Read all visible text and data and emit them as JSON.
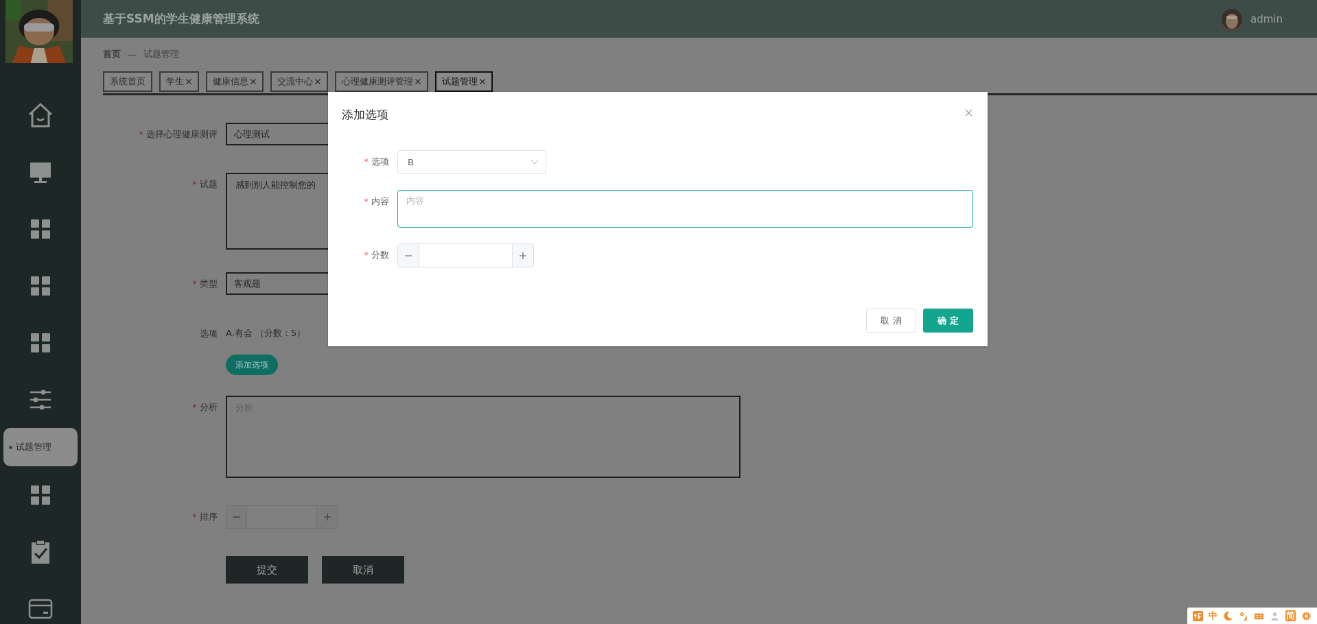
{
  "header": {
    "title": "基于SSM的学生健康管理系统",
    "user": "admin"
  },
  "sidebar": {
    "items": [
      {
        "kind": "home"
      },
      {
        "kind": "monitor"
      },
      {
        "kind": "grid"
      },
      {
        "kind": "grid"
      },
      {
        "kind": "grid"
      },
      {
        "kind": "sliders",
        "popup": "试题管理"
      },
      {
        "kind": "grid"
      },
      {
        "kind": "clipboard"
      },
      {
        "kind": "card"
      }
    ]
  },
  "breadcrumb": {
    "items": [
      "首页",
      "试题管理"
    ],
    "separator": "—"
  },
  "tabs": [
    {
      "label": "系统首页",
      "closable": false,
      "selected": false
    },
    {
      "label": "学生",
      "closable": true,
      "selected": false
    },
    {
      "label": "健康信息",
      "closable": true,
      "selected": false
    },
    {
      "label": "交流中心",
      "closable": true,
      "selected": false
    },
    {
      "label": "心理健康测评管理",
      "closable": true,
      "selected": false
    },
    {
      "label": "试题管理",
      "closable": true,
      "selected": true
    }
  ],
  "form": {
    "fields": [
      {
        "kind": "input",
        "label": "选择心理健康测评",
        "mark": "*",
        "value": "心理测试"
      },
      {
        "kind": "textarea",
        "label": "试题",
        "mark": "*",
        "value": "感到别人能控制您的"
      },
      {
        "kind": "input",
        "label": "类型",
        "mark": "*",
        "value": "客观题"
      },
      {
        "kind": "options",
        "label": "选项",
        "items": [
          "A.有会 （分数：5）"
        ],
        "button": "添加选项"
      },
      {
        "kind": "textarea",
        "label": "分析",
        "mark": "*",
        "placeholder": "分析"
      },
      {
        "kind": "number",
        "label": "排序",
        "mark": "*"
      }
    ],
    "buttons": [
      "提交",
      "取消"
    ]
  },
  "dialog": {
    "title": "添加选项",
    "fields": [
      {
        "kind": "select",
        "label": "选项",
        "mark": "*",
        "value": "B"
      },
      {
        "kind": "textarea",
        "label": "内容",
        "mark": "*",
        "placeholder": "内容",
        "focused": true
      },
      {
        "kind": "number",
        "label": "分数",
        "mark": "*"
      }
    ],
    "buttons": [
      {
        "label": "取 消",
        "primary": false
      },
      {
        "label": "确 定",
        "primary": true
      }
    ]
  },
  "ime_bar": {
    "mode": "中",
    "script": "简"
  }
}
